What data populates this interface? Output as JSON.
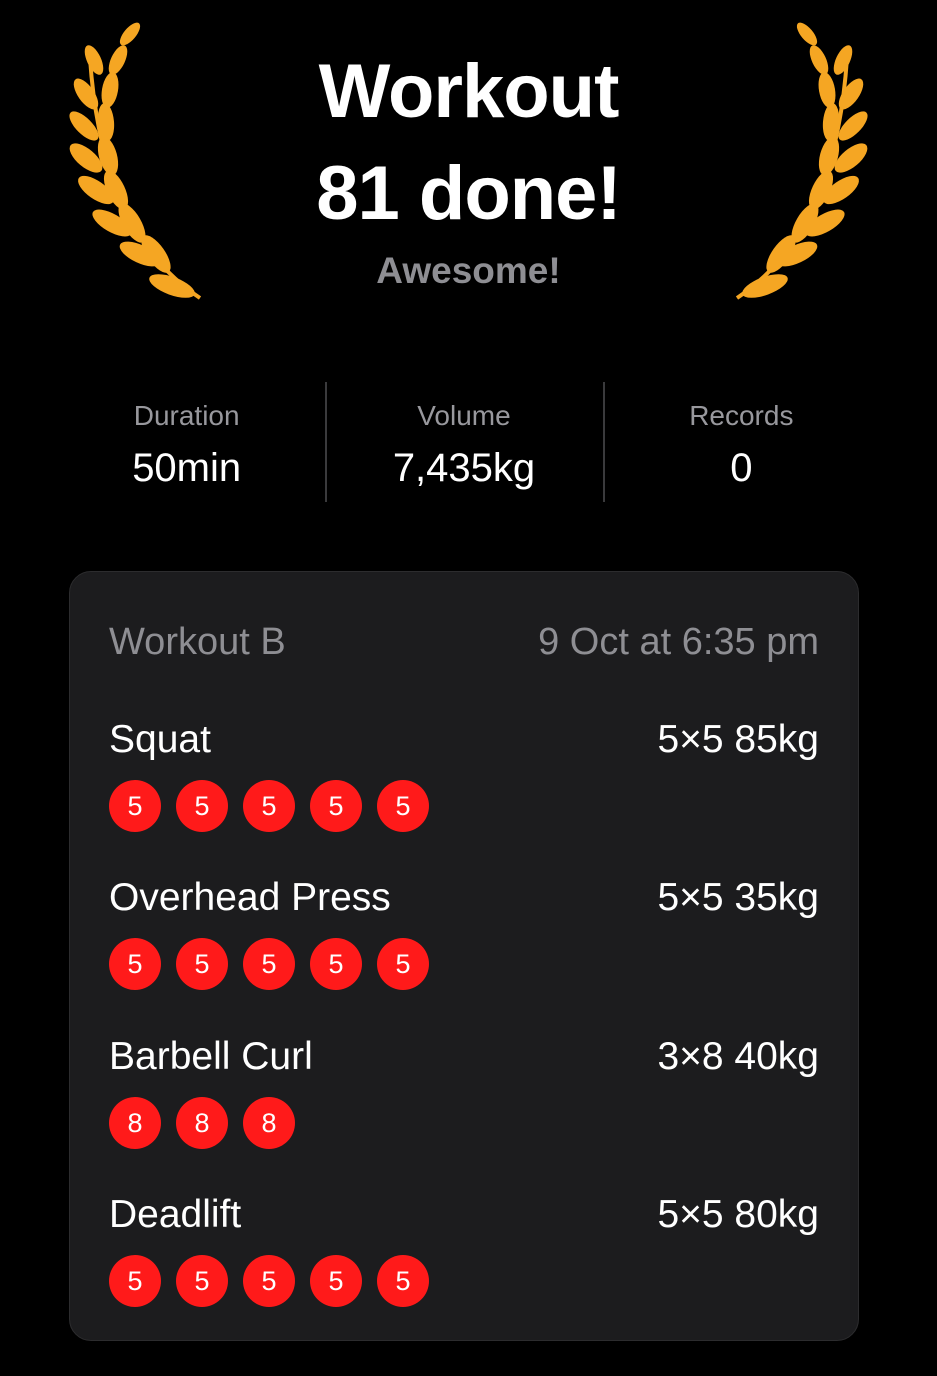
{
  "header": {
    "title_line1": "Workout",
    "title_line2": "81 done!",
    "subtitle": "Awesome!",
    "laurel_color": "#f5a623",
    "laurel_icon": "laurel-wreath"
  },
  "stats": [
    {
      "label": "Duration",
      "value": "50min"
    },
    {
      "label": "Volume",
      "value": "7,435kg"
    },
    {
      "label": "Records",
      "value": "0"
    }
  ],
  "workout": {
    "name": "Workout B",
    "datetime": "9 Oct at 6:35 pm",
    "exercises": [
      {
        "name": "Squat",
        "scheme": "5×5 85kg",
        "sets": [
          "5",
          "5",
          "5",
          "5",
          "5"
        ]
      },
      {
        "name": "Overhead Press",
        "scheme": "5×5 35kg",
        "sets": [
          "5",
          "5",
          "5",
          "5",
          "5"
        ]
      },
      {
        "name": "Barbell Curl",
        "scheme": "3×8 40kg",
        "sets": [
          "8",
          "8",
          "8"
        ]
      },
      {
        "name": "Deadlift",
        "scheme": "5×5 80kg",
        "sets": [
          "5",
          "5",
          "5",
          "5",
          "5"
        ]
      }
    ]
  },
  "colors": {
    "background": "#000000",
    "card": "#1c1c1e",
    "set_badge": "#ff1a1a",
    "muted_text": "#8e8e93"
  }
}
